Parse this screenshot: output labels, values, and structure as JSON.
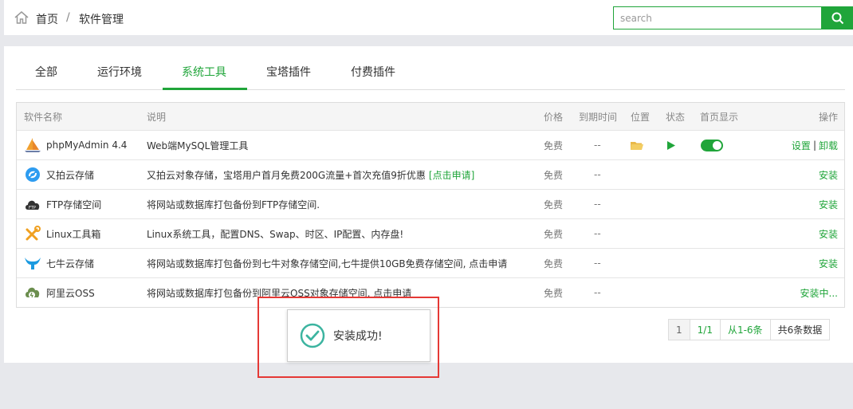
{
  "breadcrumb": {
    "home": "首页",
    "separator": "/",
    "current": "软件管理"
  },
  "search": {
    "placeholder": "search",
    "icon": "search-icon"
  },
  "tabs": [
    {
      "label": "全部",
      "active": false
    },
    {
      "label": "运行环境",
      "active": false
    },
    {
      "label": "系统工具",
      "active": true
    },
    {
      "label": "宝塔插件",
      "active": false
    },
    {
      "label": "付费插件",
      "active": false
    }
  ],
  "table": {
    "headers": {
      "name": "软件名称",
      "desc": "说明",
      "price": "价格",
      "expire": "到期时间",
      "position": "位置",
      "state": "状态",
      "homepage": "首页显示",
      "op": "操作"
    },
    "rows": [
      {
        "name": "phpMyAdmin 4.4",
        "icon": "phpmyadmin-icon",
        "desc": "Web端MySQL管理工具",
        "price": "免费",
        "expire": "--",
        "op1": "设置",
        "op_sep": "|",
        "op2": "卸载"
      },
      {
        "name": "又拍云存储",
        "icon": "upyun-icon",
        "desc": "又拍云对象存储，宝塔用户首月免费200G流量+首次充值9折优惠",
        "desc_link": "[点击申请]",
        "price": "免费",
        "expire": "--",
        "op1": "安装"
      },
      {
        "name": "FTP存储空间",
        "icon": "ftp-cloud-icon",
        "desc": "将网站或数据库打包备份到FTP存储空间.",
        "price": "免费",
        "expire": "--",
        "op1": "安装"
      },
      {
        "name": "Linux工具箱",
        "icon": "toolbox-icon",
        "desc": "Linux系统工具，配置DNS、Swap、时区、IP配置、内存盘!",
        "price": "免费",
        "expire": "--",
        "op1": "安装"
      },
      {
        "name": "七牛云存储",
        "icon": "qiniu-icon",
        "desc": "将网站或数据库打包备份到七牛对象存储空间,七牛提供10GB免费存储空间, 点击申请",
        "price": "免费",
        "expire": "--",
        "op1": "安装"
      },
      {
        "name": "阿里云OSS",
        "icon": "aliyun-oss-icon",
        "desc": "将网站或数据库打包备份到阿里云OSS对象存储空间, 点击申请",
        "price": "免费",
        "expire": "--",
        "op1": "安装中..."
      }
    ]
  },
  "pagination": {
    "page": "1",
    "pages": "1/1",
    "range": "从1-6条",
    "total": "共6条数据"
  },
  "toast": {
    "message": "安装成功!"
  },
  "colors": {
    "accent": "#20a53a",
    "highlight": "#e53935"
  }
}
